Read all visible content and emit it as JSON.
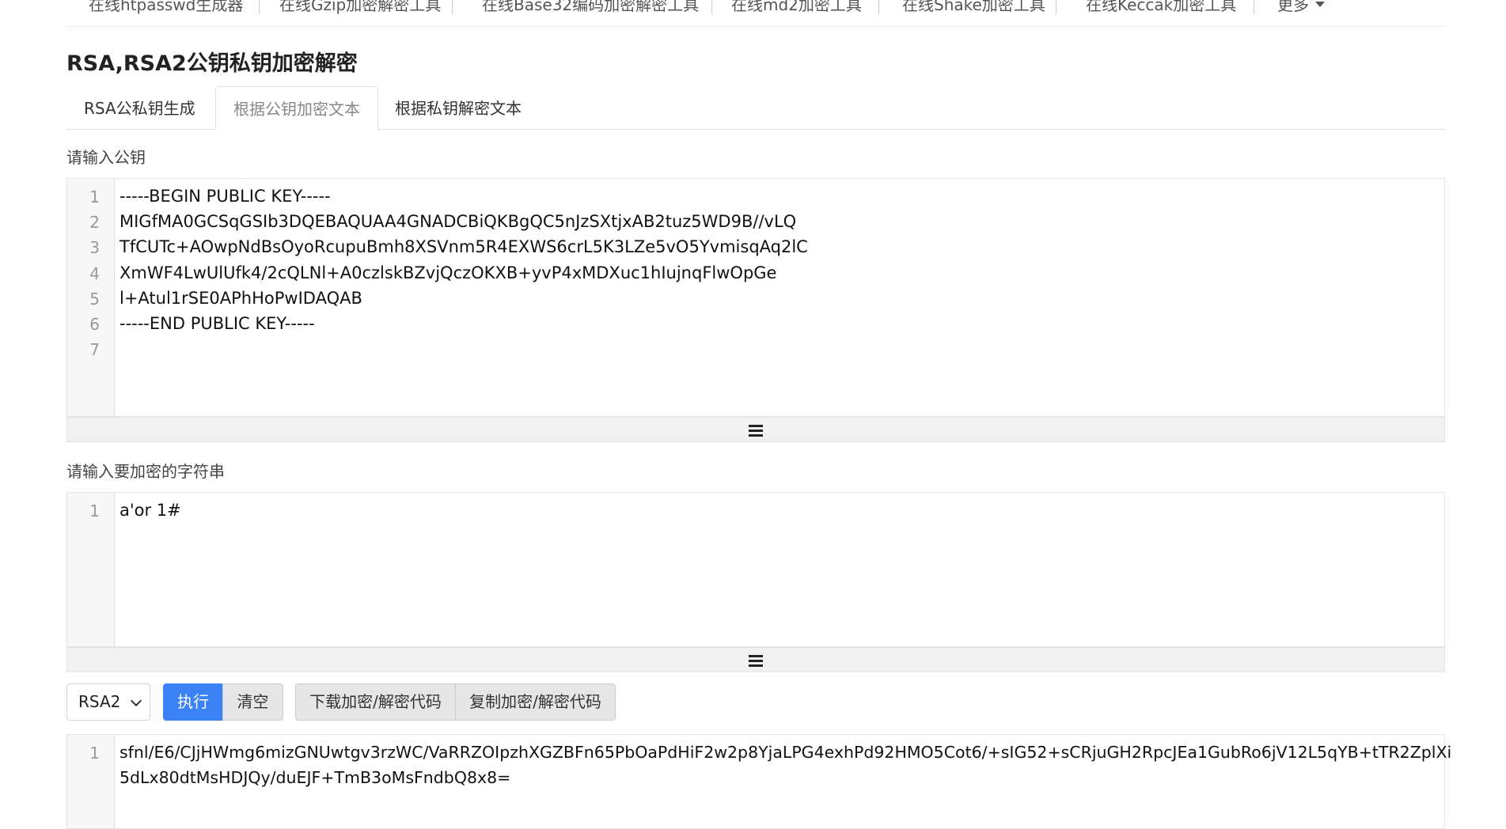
{
  "nav": {
    "items": [
      "在线htpasswd生成器",
      "在线Gzip加密解密工具",
      "在线Base32编码加密解密工具",
      "在线md2加密工具",
      "在线Shake加密工具",
      "在线Keccak加密工具"
    ],
    "more": "更多"
  },
  "page": {
    "title": "RSA,RSA2公钥私钥加密解密"
  },
  "tabs": [
    {
      "label": "RSA公私钥生成",
      "active": false
    },
    {
      "label": "根据公钥加密文本",
      "active": true
    },
    {
      "label": "根据私钥解密文本",
      "active": false
    }
  ],
  "public_key": {
    "label": "请输入公钥",
    "lines": [
      "-----BEGIN PUBLIC KEY-----",
      "MIGfMA0GCSqGSIb3DQEBAQUAA4GNADCBiQKBgQC5nJzSXtjxAB2tuz5WD9B//vLQ",
      "TfCUTc+AOwpNdBsOyoRcupuBmh8XSVnm5R4EXWS6crL5K3LZe5vO5YvmisqAq2lC",
      "XmWF4LwUlUfk4/2cQLNl+A0czlskBZvjQczOKXB+yvP4xMDXuc1hIujnqFlwOpGe",
      "l+Atul1rSE0APhHoPwIDAQAB",
      "-----END PUBLIC KEY-----",
      ""
    ]
  },
  "plaintext": {
    "label": "请输入要加密的字符串",
    "lines": [
      "a'or 1#"
    ]
  },
  "controls": {
    "algorithm_selected": "RSA2",
    "execute_label": "执行",
    "clear_label": "清空",
    "download_label": "下载加密/解密代码",
    "copy_label": "复制加密/解密代码"
  },
  "output": {
    "lines": [
      "sfnl/E6/CJjHWmg6mizGNUwtgv3rzWC/VaRRZOIpzhXGZBFn65PbOaPdHiF2w2p8YjaLPG4exhPd92HMO5Cot6/+sIG52+sCRjuGH2RpcJEa1GubRo6jV12L5qYB+tTR2ZplXi5dLx80dtMsHDJQy/duEJF+TmB3oMsFndbQ8x8="
    ],
    "display_rows": [
      "sfnl/E6/CJjHWmg6mizGNUwtgv3rzWC/VaRRZOIpzhXGZBFn65PbOaPdHiF2w2p8YjaLPG4exhPd92HMO5Cot6/+sIG52+sCRjuGH2RpcJEa1GubRo6jV12L5qYB+tTR2ZplXi",
      "5dLx80dtMsHDJQy/duEJF+TmB3oMsFndbQ8x8="
    ]
  }
}
